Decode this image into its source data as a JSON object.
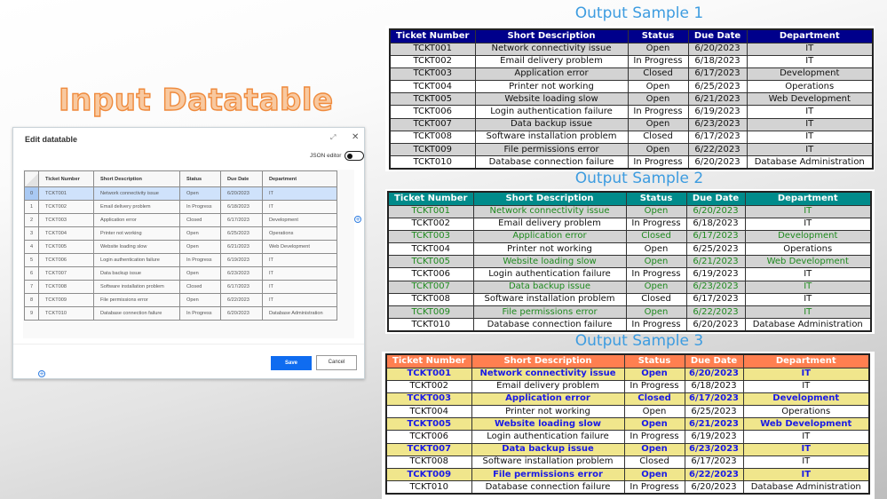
{
  "left": {
    "heading": "Input Datatable",
    "dialog": {
      "title": "Edit datatable",
      "expand_icon": "⤢",
      "close_icon": "✕",
      "json_editor_label": "JSON editor",
      "json_editor_on": false,
      "selected_row": 0,
      "columns": [
        "Ticket Number",
        "Short Description",
        "Status",
        "Due Date",
        "Department"
      ],
      "add_column_icon": "+",
      "add_row_icon": "+",
      "save_label": "Save",
      "cancel_label": "Cancel",
      "save_color": "#0f6cf0"
    }
  },
  "rows": [
    {
      "idx": "0",
      "ticket": "TCKT001",
      "desc": "Network connectivity issue",
      "status": "Open",
      "due": "6/20/2023",
      "dept": "IT"
    },
    {
      "idx": "1",
      "ticket": "TCKT002",
      "desc": "Email delivery problem",
      "status": "In Progress",
      "due": "6/18/2023",
      "dept": "IT"
    },
    {
      "idx": "2",
      "ticket": "TCKT003",
      "desc": "Application error",
      "status": "Closed",
      "due": "6/17/2023",
      "dept": "Development"
    },
    {
      "idx": "3",
      "ticket": "TCKT004",
      "desc": "Printer not working",
      "status": "Open",
      "due": "6/25/2023",
      "dept": "Operations"
    },
    {
      "idx": "4",
      "ticket": "TCKT005",
      "desc": "Website loading slow",
      "status": "Open",
      "due": "6/21/2023",
      "dept": "Web Development"
    },
    {
      "idx": "5",
      "ticket": "TCKT006",
      "desc": "Login authentication failure",
      "status": "In Progress",
      "due": "6/19/2023",
      "dept": "IT"
    },
    {
      "idx": "6",
      "ticket": "TCKT007",
      "desc": "Data backup issue",
      "status": "Open",
      "due": "6/23/2023",
      "dept": "IT"
    },
    {
      "idx": "7",
      "ticket": "TCKT008",
      "desc": "Software installation problem",
      "status": "Closed",
      "due": "6/17/2023",
      "dept": "IT"
    },
    {
      "idx": "8",
      "ticket": "TCKT009",
      "desc": "File permissions error",
      "status": "Open",
      "due": "6/22/2023",
      "dept": "IT"
    },
    {
      "idx": "9",
      "ticket": "TCKT010",
      "desc": "Database connection failure",
      "status": "In Progress",
      "due": "6/20/2023",
      "dept": "Database Administration"
    }
  ],
  "samples": [
    {
      "title": "Output Sample 1",
      "header_bg": "#00008b",
      "alt_row_bg": "#d3d3d3",
      "alt_row_text": "#111111"
    },
    {
      "title": "Output Sample 2",
      "header_bg": "#008b8b",
      "alt_row_bg": "#d3d3d3",
      "alt_row_text": "#1f8a1f"
    },
    {
      "title": "Output Sample 3",
      "header_bg": "#ff7f50",
      "alt_row_bg": "#f0e68c",
      "alt_row_text": "#1a1ae6"
    }
  ],
  "output_columns": [
    "Ticket Number",
    "Short Description",
    "Status",
    "Due Date",
    "Department"
  ]
}
